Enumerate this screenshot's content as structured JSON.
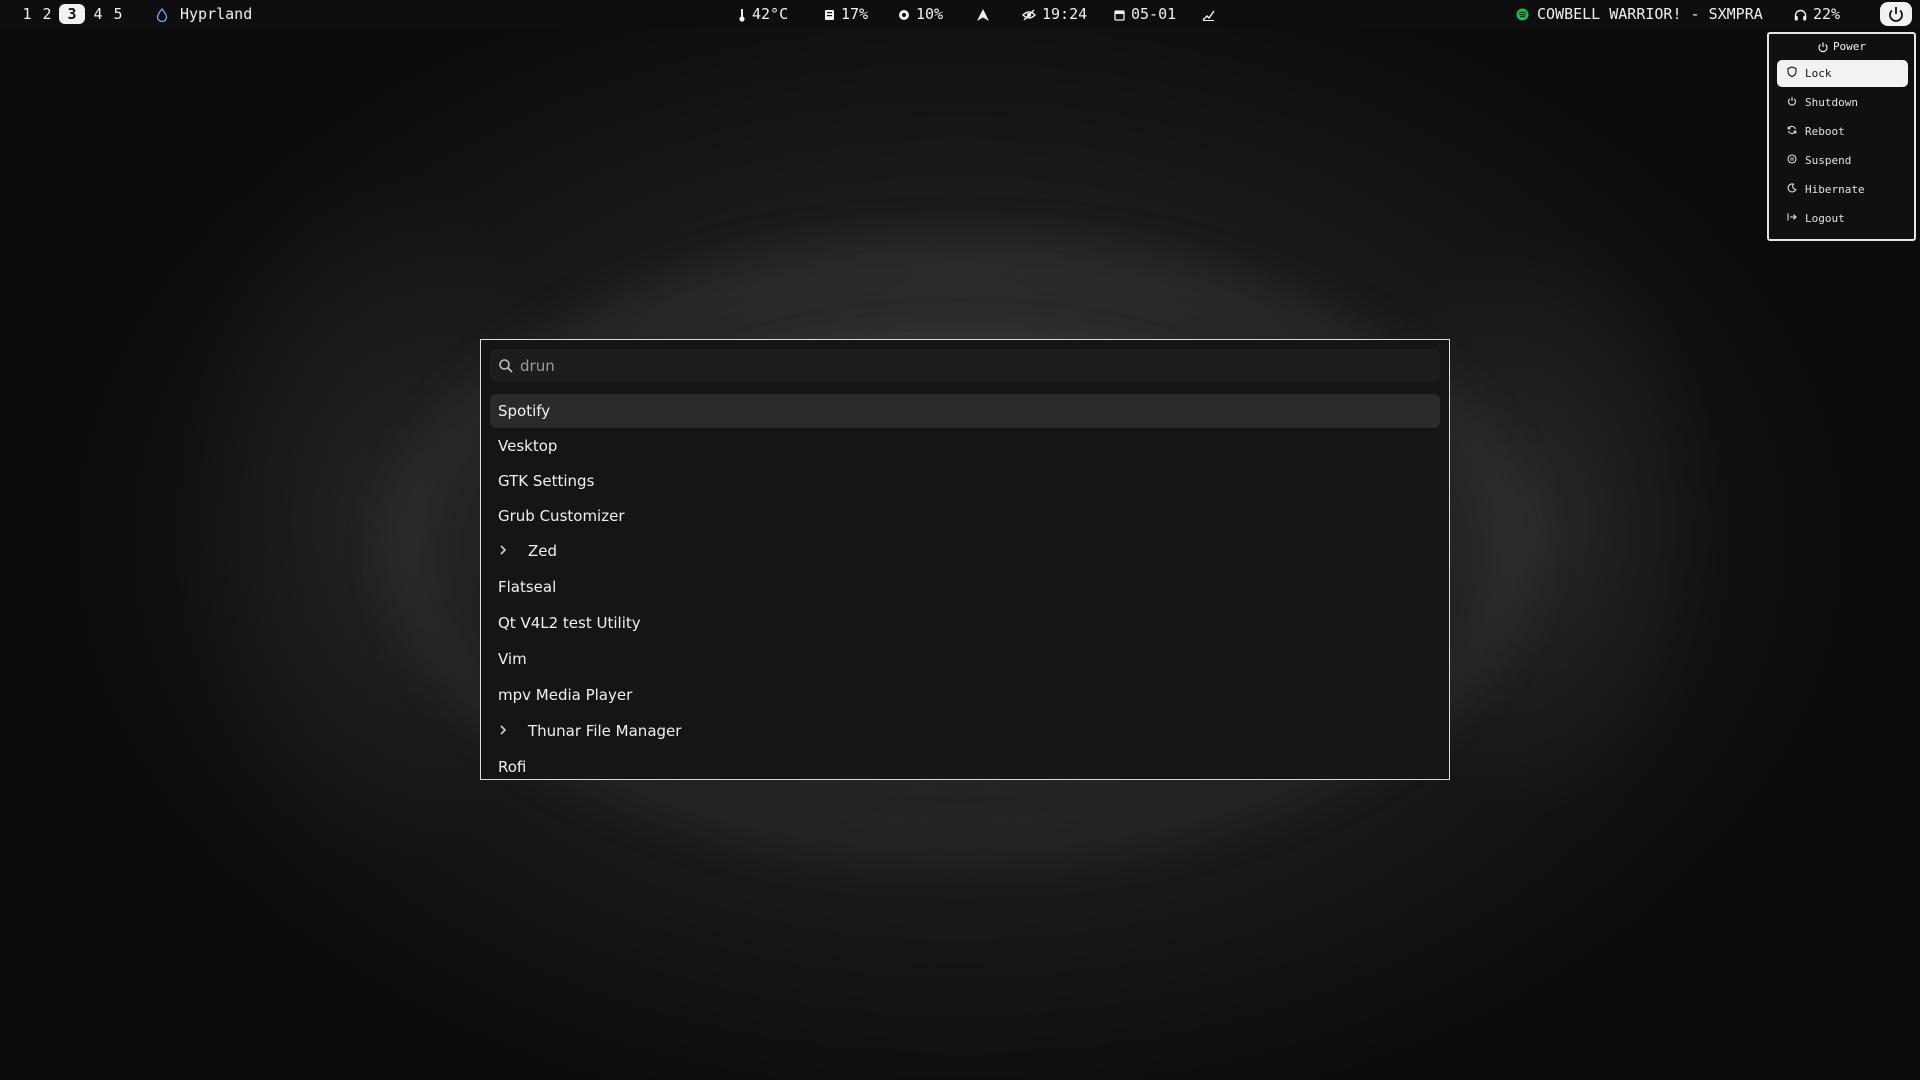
{
  "topbar": {
    "workspaces": [
      "1",
      "2",
      "3",
      "4",
      "5"
    ],
    "active_workspace": "3",
    "window_title": "Hyprland",
    "temperature": "42°C",
    "memory": "17%",
    "cpu": "10%",
    "clock": "19:24",
    "date": "05-01",
    "now_playing": "COWBELL WARRIOR! - SXMPRA",
    "volume": "22%",
    "icons": [
      "droplet-icon",
      "thermometer-icon",
      "memory-icon",
      "cpu-icon",
      "arch-icon",
      "eye-off-icon",
      "calendar-icon",
      "check-icon",
      "spotify-icon",
      "headphones-icon",
      "power-icon"
    ]
  },
  "power_menu": {
    "title": "Power",
    "items": [
      {
        "label": "Lock",
        "icon": "shield-icon"
      },
      {
        "label": "Shutdown",
        "icon": "power-icon"
      },
      {
        "label": "Reboot",
        "icon": "refresh-icon"
      },
      {
        "label": "Suspend",
        "icon": "pause-icon"
      },
      {
        "label": "Hibernate",
        "icon": "moon-icon"
      },
      {
        "label": "Logout",
        "icon": "logout-icon"
      }
    ],
    "selected_index": 0
  },
  "launcher": {
    "search": {
      "placeholder": "drun",
      "value": ""
    },
    "results": [
      {
        "label": "Spotify"
      },
      {
        "label": "Vesktop"
      },
      {
        "label": "GTK Settings"
      },
      {
        "label": "Grub Customizer"
      },
      {
        "label": "Zed",
        "expandable": true
      },
      {
        "label": "Flatseal"
      },
      {
        "label": "Qt V4L2 test Utility"
      },
      {
        "label": "Vim"
      },
      {
        "label": "mpv Media Player"
      },
      {
        "label": "Thunar File Manager",
        "expandable": true
      },
      {
        "label": "Rofi"
      }
    ],
    "selected_index": 0
  },
  "colors": {
    "bar_bg": "#0e0e0e",
    "accent": "#f2f2f2",
    "spotify_green": "#1db954",
    "launcher_bg": "#151515",
    "selected_row": "#2a2a2a"
  }
}
